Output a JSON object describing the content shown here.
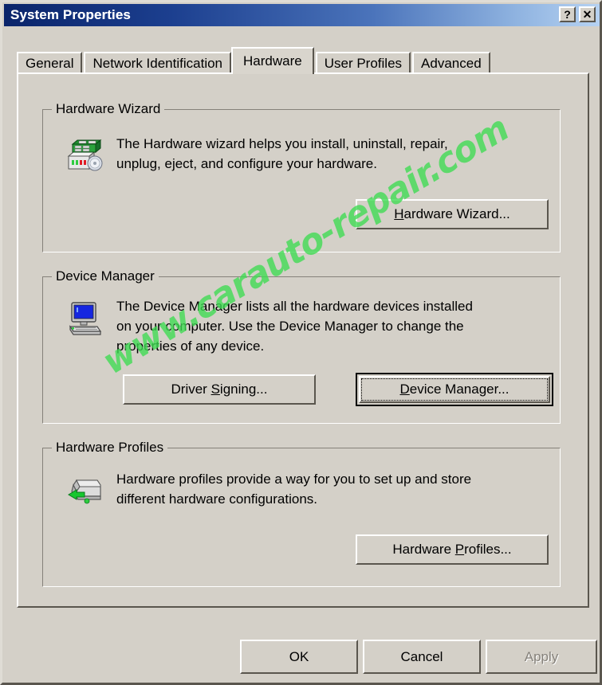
{
  "window": {
    "title": "System Properties",
    "titlebar_buttons": [
      {
        "name": "help-button",
        "glyph": "?"
      },
      {
        "name": "close-button",
        "glyph": "✕"
      }
    ],
    "colors": {
      "titlebar_start": "#0a246a",
      "titlebar_end": "#b6d2f2",
      "face": "#d4d0c8",
      "text": "#000000",
      "disabled_text": "#85817a",
      "watermark": "#3ddc52"
    }
  },
  "tabs": [
    {
      "label": "General",
      "active": false
    },
    {
      "label": "Network Identification",
      "active": false
    },
    {
      "label": "Hardware",
      "active": true
    },
    {
      "label": "User Profiles",
      "active": false
    },
    {
      "label": "Advanced",
      "active": false
    }
  ],
  "groups": {
    "hardware_wizard": {
      "title": "Hardware Wizard",
      "icon": "circuit-board-drive-icon",
      "description": "The Hardware wizard helps you install, uninstall, repair,\nunplug, eject, and configure your hardware.",
      "button": {
        "label_before": "",
        "accel": "H",
        "label_after": "ardware Wizard...",
        "full_label": "Hardware Wizard..."
      }
    },
    "device_manager": {
      "title": "Device Manager",
      "icon": "computer-icon",
      "description": "The Device Manager lists all the hardware devices installed\non your computer. Use the Device Manager to change the\nproperties of any device.",
      "buttons": [
        {
          "label_before": "Driver ",
          "accel": "S",
          "label_after": "igning...",
          "full_label": "Driver Signing...",
          "default": false
        },
        {
          "label_before": "",
          "accel": "D",
          "label_after": "evice Manager...",
          "full_label": "Device Manager...",
          "default": true
        }
      ]
    },
    "hardware_profiles": {
      "title": "Hardware Profiles",
      "icon": "hardware-profile-box-icon",
      "description": "Hardware profiles provide a way for you to set up and store\ndifferent hardware configurations.",
      "button": {
        "label_before": "Hardware ",
        "accel": "P",
        "label_after": "rofiles...",
        "full_label": "Hardware Profiles..."
      }
    }
  },
  "dialog_buttons": [
    {
      "label": "OK",
      "enabled": true,
      "name": "ok-button"
    },
    {
      "label": "Cancel",
      "enabled": true,
      "name": "cancel-button"
    },
    {
      "label": "Apply",
      "enabled": false,
      "name": "apply-button"
    }
  ],
  "watermark": {
    "text": "www.carauto-repair.com"
  }
}
